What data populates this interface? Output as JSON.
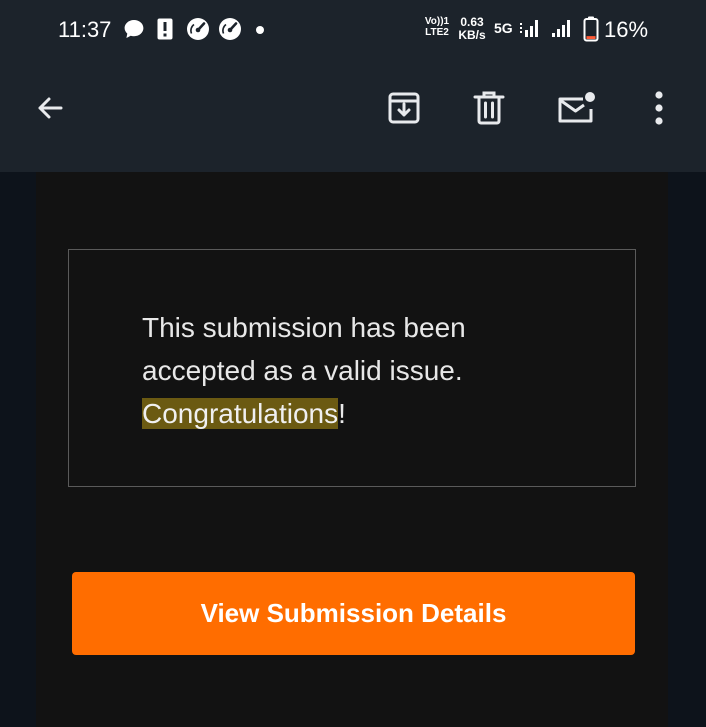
{
  "status_bar": {
    "time": "11:37",
    "volte_line1": "Vo))1",
    "volte_line2": "LTE2",
    "speed_value": "0.63",
    "speed_unit": "KB/s",
    "network": "5G",
    "battery_percent": "16%",
    "icons": [
      "chat-bubble-icon",
      "alert-card-icon",
      "speedometer-icon",
      "speedometer-icon",
      "dot-icon",
      "signal-icon",
      "signal-icon",
      "battery-icon"
    ],
    "battery_level": 0.16,
    "battery_color": "#ff5a36"
  },
  "app_bar": {
    "actions": [
      "back-arrow-icon",
      "archive-icon",
      "trash-icon",
      "mark-unread-icon",
      "more-vert-icon"
    ]
  },
  "message": {
    "line1": "This submission has been",
    "line2": "accepted as a valid issue.",
    "highlighted": "Congratulations",
    "suffix": "!"
  },
  "cta": {
    "label": "View Submission Details",
    "color": "#ff6d00"
  },
  "colors": {
    "app_bar_bg": "#1c232b",
    "page_bg": "#0d131b",
    "content_bg": "#121212",
    "highlight_bg": "#6b5a12"
  }
}
